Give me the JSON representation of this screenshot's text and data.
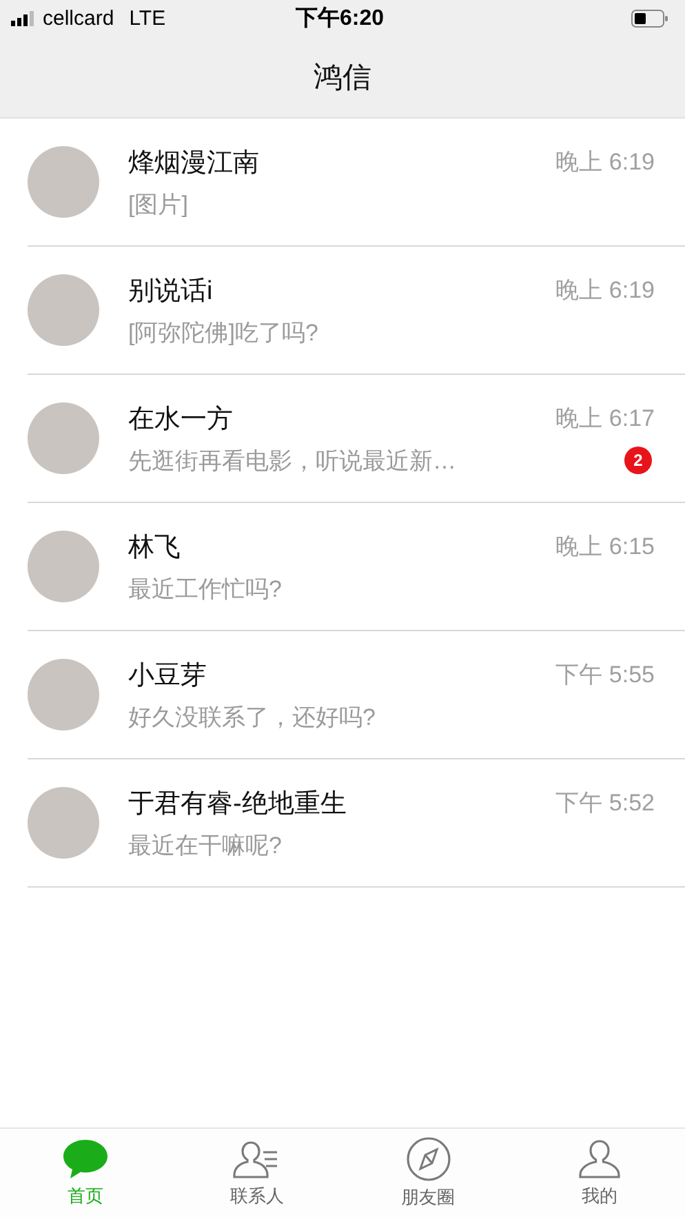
{
  "status_bar": {
    "carrier": "cellcard",
    "network": "LTE",
    "time": "下午6:20"
  },
  "title": "鸿信",
  "chats": [
    {
      "name": "烽烟漫江南",
      "preview": "[图片]",
      "time": "晚上 6:19"
    },
    {
      "name": "别说话i",
      "preview": "[阿弥陀佛]吃了吗?",
      "time": "晚上 6:19"
    },
    {
      "name": "在水一方",
      "preview": "先逛街再看电影，听说最近新…",
      "time": "晚上 6:17",
      "unread": "2"
    },
    {
      "name": "林飞",
      "preview": "最近工作忙吗?",
      "time": "晚上 6:15"
    },
    {
      "name": "小豆芽",
      "preview": "好久没联系了，还好吗?",
      "time": "下午 5:55"
    },
    {
      "name": "于君有睿-绝地重生",
      "preview": "最近在干嘛呢?",
      "time": "下午 5:52"
    }
  ],
  "tabs": [
    {
      "kind": "chat",
      "label": "首页",
      "selected": true
    },
    {
      "kind": "contacts",
      "label": "联系人",
      "selected": false
    },
    {
      "kind": "compass",
      "label": "朋友圈",
      "selected": false
    },
    {
      "kind": "person",
      "label": "我的",
      "selected": false
    }
  ]
}
